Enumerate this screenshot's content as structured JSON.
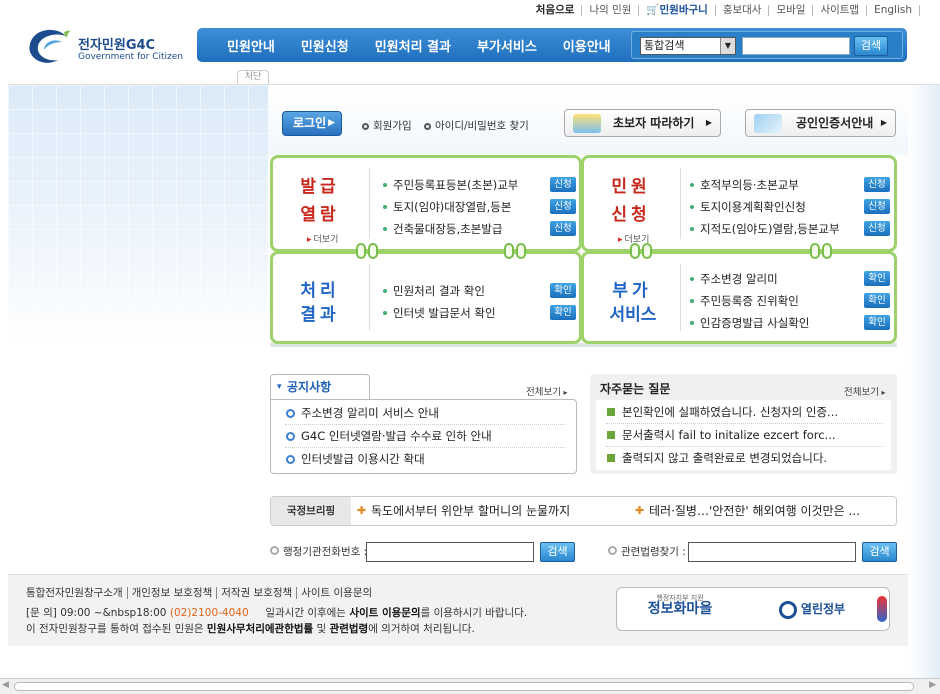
{
  "toplinks": [
    "처음으로",
    "나의 민원",
    "민원바구니",
    "홍보대사",
    "모바일",
    "사이트맵",
    "English"
  ],
  "logo": {
    "title": "전자민원G4C",
    "subtitle": "Government for Citizen"
  },
  "nav": {
    "items": [
      "민원안내",
      "민원신청",
      "민원처리 결과",
      "부가서비스",
      "이용안내"
    ],
    "search_select": "통합검색",
    "search_button": "검색"
  },
  "skip_tab": "처단",
  "login": {
    "button": "로그인",
    "join": "회원가입",
    "find": "아이디/비밀번호 찾기"
  },
  "guides": {
    "beginner": "초보자 따라하기",
    "cert": "공인인증서안내"
  },
  "services": {
    "issue": {
      "title_top": "발급",
      "title_bottom": "열람",
      "more": "더보기",
      "items": [
        {
          "label": "주민등록표등본(초본)교부",
          "badge": "신청"
        },
        {
          "label": "토지(임야)대장열람,등본",
          "badge": "신청"
        },
        {
          "label": "건축물대장등,초본발급",
          "badge": "신청"
        }
      ]
    },
    "apply": {
      "title_top": "민원",
      "title_bottom": "신청",
      "more": "더보기",
      "items": [
        {
          "label": "호적부의등·초본교부",
          "badge": "신청"
        },
        {
          "label": "토지이용계획확인신청",
          "badge": "신청"
        },
        {
          "label": "지적도(임야도)열람,등본교부",
          "badge": "신청"
        }
      ]
    },
    "result": {
      "title_top": "처리",
      "title_bottom": "결과",
      "items": [
        {
          "label": "민원처리 결과 확인",
          "badge": "확인"
        },
        {
          "label": "인터넷 발급문서 확인",
          "badge": "확인"
        }
      ]
    },
    "extra": {
      "title_top": "부가",
      "title_bottom": "서비스",
      "items": [
        {
          "label": "주소변경 알리미",
          "badge": "확인"
        },
        {
          "label": "주민등록증 진위확인",
          "badge": "확인"
        },
        {
          "label": "인감증명발급 사실확인",
          "badge": "확인"
        }
      ]
    }
  },
  "notice": {
    "title": "공지사항",
    "view_all": "전체보기",
    "items": [
      "주소변경 알리미 서비스 안내",
      "G4C 인터넷열람·발급 수수료 인하 안내",
      "인터넷발급 이용시간 확대"
    ]
  },
  "faq": {
    "title": "자주묻는 질문",
    "view_all": "전체보기",
    "items": [
      "본인확인에 실패하였습니다. 신청자의 인증...",
      "문서출력시 fail to initalize ezcert forc...",
      "출력되지 않고 출력완료로 변경되었습니다."
    ]
  },
  "briefing": {
    "label": "국정브리핑",
    "items": [
      "독도에서부터 위안부 할머니의 눈물까지",
      "테러·질병…'안전한' 해외여행 이것만은 ..."
    ]
  },
  "phone_search": {
    "label": "행정기관전화번호 :",
    "button": "검색"
  },
  "law_search": {
    "label": "관련법령찾기 :",
    "button": "검색"
  },
  "footer": {
    "links": [
      "통합전자민원창구소개",
      "개인정보 보호정책",
      "저작권 보호정책",
      "사이트 이용문의"
    ],
    "line2_prefix": "[문 의]  09:00 ~&nbsp18:00",
    "line2_tel": "(02)2100-4040",
    "line2_mid": "일과시간 이후에는",
    "line2_bold": "사이트 이용문의",
    "line2_suffix": "를 이용하시기 바랍니다.",
    "line3_prefix": "이 전자민원창구를 통하여 접수된 민원은",
    "line3_bold1": "민원사무처리에관한법률",
    "line3_mid": "및",
    "line3_bold2": "관련법령",
    "line3_suffix": "에 의거하여 처리됩니다.",
    "badge1_small": "행정자치부 지원",
    "badge1": "정보화마을",
    "badge2": "열린정부"
  },
  "colors": {
    "nav_blue": "#2a7dc9",
    "service_green": "#9dd26a",
    "title_red": "#c8281c",
    "title_blue": "#2065c4"
  }
}
